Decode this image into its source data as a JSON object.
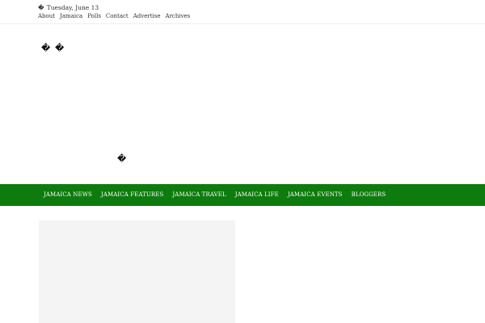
{
  "topbar": {
    "date_glyph": "�",
    "date_text": "Tuesday, June 13",
    "links": [
      "About",
      "Jamaica",
      "Polls",
      "Contact",
      "Advertise",
      "Archives"
    ]
  },
  "header": {
    "glyph_1": "�",
    "glyph_2": "�",
    "glyph_3": "�"
  },
  "main_nav": {
    "items": [
      "JAMAICA NEWS",
      "JAMAICA FEATURES",
      "JAMAICA TRAVEL",
      "JAMAICA LIFE",
      "JAMAICA EVENTS",
      "BLOGGERS"
    ]
  },
  "colors": {
    "nav_background": "#0e7b0e",
    "content_placeholder": "#f4f4f4"
  }
}
